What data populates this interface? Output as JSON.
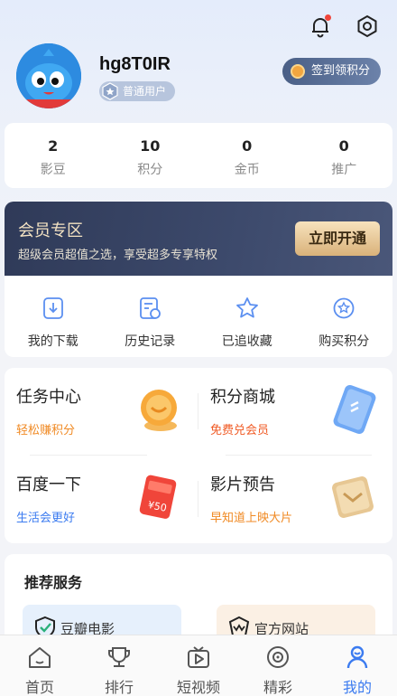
{
  "header": {
    "icons": [
      "bell-icon",
      "settings-icon"
    ],
    "notification_dot_color": "#f0453a"
  },
  "profile": {
    "username": "hg8T0IR",
    "level": "普通用户",
    "sign_button": "签到领积分",
    "avatar_color": "#2d8be0"
  },
  "stats": [
    {
      "value": "2",
      "label": "影豆"
    },
    {
      "value": "10",
      "label": "积分"
    },
    {
      "value": "0",
      "label": "金币"
    },
    {
      "value": "0",
      "label": "推广"
    }
  ],
  "vip": {
    "title": "会员专区",
    "subtitle": "超级会员超值之选，享受超多专享特权",
    "button": "立即开通"
  },
  "quick_links": [
    {
      "label": "我的下载",
      "icon": "download-icon"
    },
    {
      "label": "历史记录",
      "icon": "history-icon"
    },
    {
      "label": "已追收藏",
      "icon": "star-icon"
    },
    {
      "label": "购买积分",
      "icon": "points-icon"
    }
  ],
  "tasks": [
    {
      "title": "任务中心",
      "subtitle": "轻松赚积分",
      "subtitle_color": "#f08a24",
      "icon": "coin-stack-icon"
    },
    {
      "title": "积分商城",
      "subtitle": "免费兑会员",
      "subtitle_color": "#f05a24",
      "icon": "card-icon"
    },
    {
      "title": "百度一下",
      "subtitle": "生活会更好",
      "subtitle_color": "#3b7bf0",
      "icon": "red-envelope-icon"
    },
    {
      "title": "影片预告",
      "subtitle": "早知道上映大片",
      "subtitle_color": "#f08a24",
      "icon": "ticket-icon"
    }
  ],
  "recommended": {
    "title": "推荐服务",
    "tiles": [
      {
        "label": "豆瓣电影",
        "icon": "shield-check-icon"
      },
      {
        "label": "官方网站",
        "icon": "crown-shield-icon"
      }
    ]
  },
  "tabbar": [
    {
      "label": "首页",
      "icon": "home-icon",
      "active": false
    },
    {
      "label": "排行",
      "icon": "trophy-icon",
      "active": false
    },
    {
      "label": "短视频",
      "icon": "video-icon",
      "active": false
    },
    {
      "label": "精彩",
      "icon": "disc-icon",
      "active": false
    },
    {
      "label": "我的",
      "icon": "user-icon",
      "active": true
    }
  ],
  "colors": {
    "accent": "#3b7bf0",
    "vip_bg": "#2f3a58",
    "vip_gold": "#d9b27a"
  }
}
